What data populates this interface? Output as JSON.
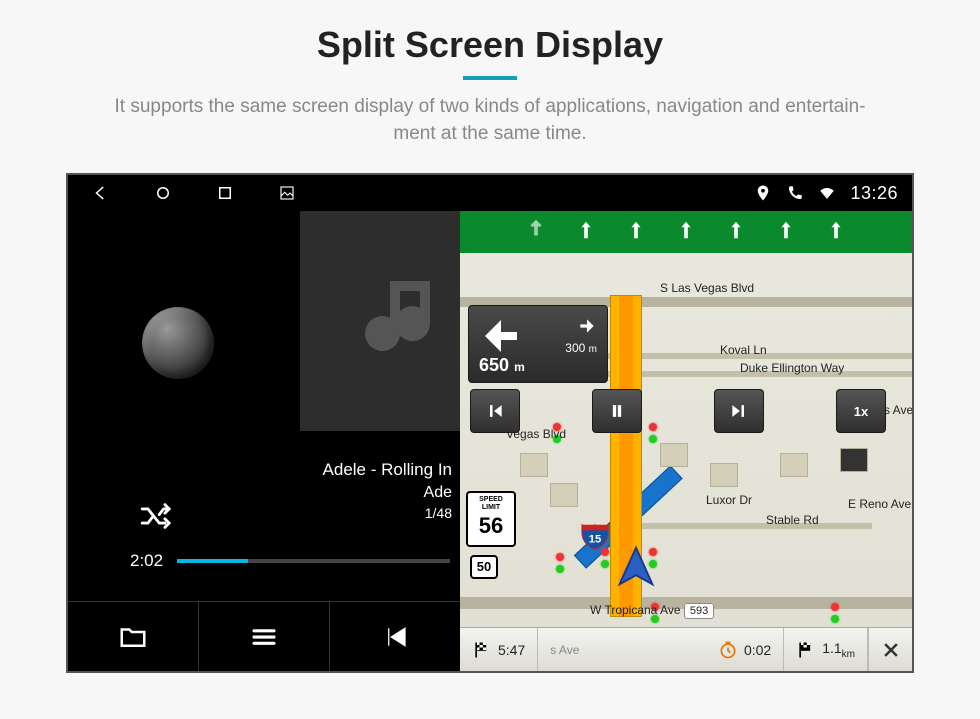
{
  "header": {
    "title": "Split Screen Display",
    "subtitle_line1": "It supports the same screen display of two kinds of applications, navigation and entertain-",
    "subtitle_line2": "ment at the same time."
  },
  "statusbar": {
    "clock": "13:26"
  },
  "music": {
    "track_title": "Adele - Rolling In",
    "artist": "Ade",
    "track_index": "1/48",
    "elapsed": "2:02",
    "icons": {
      "shuffle": "shuffle",
      "folder": "folder",
      "list": "list",
      "prev": "previous"
    }
  },
  "nav": {
    "turn": {
      "next_distance": "300",
      "next_unit": "m",
      "main_distance": "650",
      "main_unit": "m"
    },
    "controls": {
      "speed_btn": "1x"
    },
    "speed_limit": {
      "line1": "SPEED",
      "line2": "LIMIT",
      "value": "56"
    },
    "interstate": "15",
    "route_50": "50",
    "streets": {
      "s_las_vegas": "S Las Vegas Blvd",
      "koval": "Koval Ln",
      "duke": "Duke Ellington Way",
      "vegas_blvd": "Vegas Blvd",
      "luxor": "Luxor Dr",
      "stable": "Stable Rd",
      "reno": "E Reno Ave",
      "iles": "iles Ave",
      "tropicana": "W Tropicana Ave",
      "trop_num": "593",
      "s_ave": "s Ave"
    },
    "bottom": {
      "eta": "5:47",
      "time_to": "0:02",
      "distance": "1.1",
      "distance_unit": "km"
    }
  }
}
